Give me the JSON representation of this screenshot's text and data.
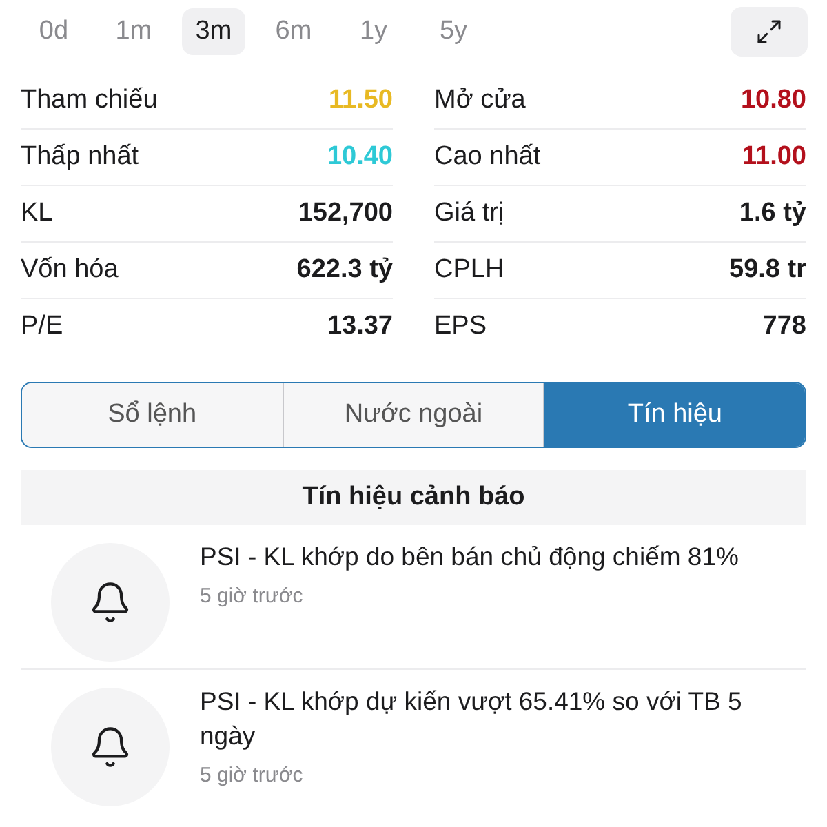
{
  "periods": [
    {
      "label": "0d",
      "selected": false
    },
    {
      "label": "1m",
      "selected": false
    },
    {
      "label": "3m",
      "selected": true
    },
    {
      "label": "6m",
      "selected": false
    },
    {
      "label": "1y",
      "selected": false
    },
    {
      "label": "5y",
      "selected": false
    }
  ],
  "stats": [
    {
      "label": "Tham chiếu",
      "value": "11.50",
      "color": "#e8b923"
    },
    {
      "label": "Mở cửa",
      "value": "10.80",
      "color": "#b3101c"
    },
    {
      "label": "Thấp nhất",
      "value": "10.40",
      "color": "#2ec9d6"
    },
    {
      "label": "Cao nhất",
      "value": "11.00",
      "color": "#b3101c"
    },
    {
      "label": "KL",
      "value": "152,700",
      "color": "#1c1c1e"
    },
    {
      "label": "Giá trị",
      "value": "1.6 tỷ",
      "color": "#1c1c1e"
    },
    {
      "label": "Vốn hóa",
      "value": "622.3 tỷ",
      "color": "#1c1c1e"
    },
    {
      "label": "CPLH",
      "value": "59.8 tr",
      "color": "#1c1c1e"
    },
    {
      "label": "P/E",
      "value": "13.37",
      "color": "#1c1c1e"
    },
    {
      "label": "EPS",
      "value": "778",
      "color": "#1c1c1e"
    }
  ],
  "segments": [
    {
      "label": "Sổ lệnh",
      "selected": false
    },
    {
      "label": "Nước ngoài",
      "selected": false
    },
    {
      "label": "Tín hiệu",
      "selected": true
    }
  ],
  "section_title": "Tín hiệu cảnh báo",
  "alerts": [
    {
      "message": "PSI - KL khớp do bên bán chủ động chiếm 81%",
      "time": "5 giờ trước"
    },
    {
      "message": "PSI - KL khớp dự kiến vượt 65.41% so với TB 5 ngày",
      "time": "5 giờ trước"
    }
  ]
}
